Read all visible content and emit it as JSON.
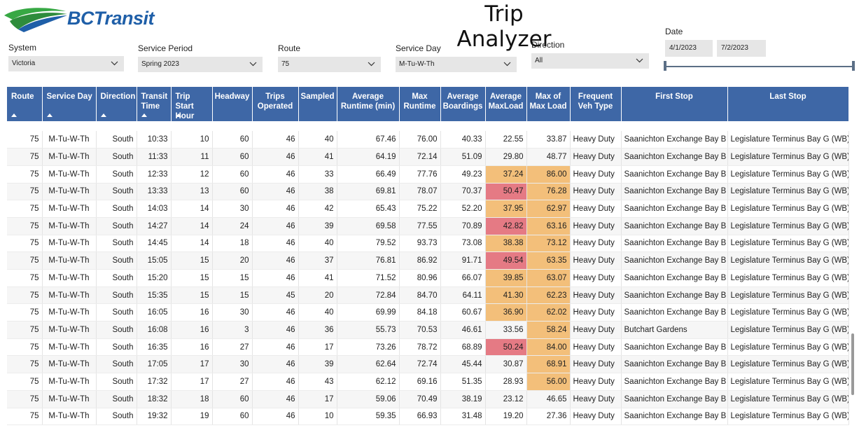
{
  "app": {
    "logo_text": "BCTransit",
    "title": "Trip Analyzer"
  },
  "colors": {
    "header_bg": "#3e67a6",
    "high_red": "#e57a84",
    "high_orange": "#f3bf7a",
    "brand_blue": "#1f5fa8",
    "brand_green": "#37a844"
  },
  "slicers": {
    "system": {
      "label": "System",
      "value": "Victoria"
    },
    "service_period": {
      "label": "Service Period",
      "value": "Spring 2023"
    },
    "route": {
      "label": "Route",
      "value": "75"
    },
    "service_day": {
      "label": "Service Day",
      "value": "M-Tu-W-Th"
    },
    "direction": {
      "label": "Direction",
      "value": "All"
    },
    "date": {
      "label": "Date",
      "start": "4/1/2023",
      "end": "7/2/2023"
    }
  },
  "table": {
    "columns": [
      "Route",
      "Service Day",
      "Direction",
      "Transit Time",
      "Trip Start Hour",
      "Headway",
      "Trips Operated",
      "Sampled",
      "Average Runtime (min)",
      "Max Runtime",
      "Average Boardings",
      "Average MaxLoad",
      "Max of Max Load",
      "Frequent Veh Type",
      "First Stop",
      "Last Stop"
    ],
    "rows": [
      [
        "75",
        "M-Tu-W-Th",
        "South",
        "10:33",
        "10",
        "60",
        "46",
        "40",
        "67.46",
        "76.00",
        "40.33",
        "22.55",
        "33.87",
        "Heavy Duty",
        "Saanichton Exchange Bay B",
        "Legislature Terminus Bay G (WB)"
      ],
      [
        "75",
        "M-Tu-W-Th",
        "South",
        "11:33",
        "11",
        "60",
        "46",
        "41",
        "64.19",
        "72.14",
        "51.09",
        "29.80",
        "48.77",
        "Heavy Duty",
        "Saanichton Exchange Bay B",
        "Legislature Terminus Bay G (WB)"
      ],
      [
        "75",
        "M-Tu-W-Th",
        "South",
        "12:33",
        "12",
        "60",
        "46",
        "33",
        "66.49",
        "77.76",
        "49.23",
        "37.24",
        "86.00",
        "Heavy Duty",
        "Saanichton Exchange Bay B",
        "Legislature Terminus Bay G (WB)"
      ],
      [
        "75",
        "M-Tu-W-Th",
        "South",
        "13:33",
        "13",
        "60",
        "46",
        "38",
        "69.81",
        "78.07",
        "70.37",
        "50.47",
        "76.28",
        "Heavy Duty",
        "Saanichton Exchange Bay B",
        "Legislature Terminus Bay G (WB)"
      ],
      [
        "75",
        "M-Tu-W-Th",
        "South",
        "14:03",
        "14",
        "30",
        "46",
        "42",
        "65.43",
        "75.22",
        "52.20",
        "37.95",
        "62.97",
        "Heavy Duty",
        "Saanichton Exchange Bay B",
        "Legislature Terminus Bay G (WB)"
      ],
      [
        "75",
        "M-Tu-W-Th",
        "South",
        "14:27",
        "14",
        "24",
        "46",
        "39",
        "69.58",
        "77.55",
        "70.89",
        "42.82",
        "63.16",
        "Heavy Duty",
        "Saanichton Exchange Bay B",
        "Legislature Terminus Bay G (WB)"
      ],
      [
        "75",
        "M-Tu-W-Th",
        "South",
        "14:45",
        "14",
        "18",
        "46",
        "40",
        "79.52",
        "93.73",
        "73.08",
        "38.38",
        "73.12",
        "Heavy Duty",
        "Saanichton Exchange Bay B",
        "Legislature Terminus Bay G (WB)"
      ],
      [
        "75",
        "M-Tu-W-Th",
        "South",
        "15:05",
        "15",
        "20",
        "46",
        "37",
        "76.81",
        "86.92",
        "91.71",
        "49.54",
        "63.35",
        "Heavy Duty",
        "Saanichton Exchange Bay B",
        "Legislature Terminus Bay G (WB)"
      ],
      [
        "75",
        "M-Tu-W-Th",
        "South",
        "15:20",
        "15",
        "15",
        "46",
        "41",
        "71.52",
        "80.96",
        "66.07",
        "39.85",
        "63.07",
        "Heavy Duty",
        "Saanichton Exchange Bay B",
        "Legislature Terminus Bay G (WB)"
      ],
      [
        "75",
        "M-Tu-W-Th",
        "South",
        "15:35",
        "15",
        "15",
        "45",
        "20",
        "72.84",
        "84.70",
        "64.11",
        "41.30",
        "62.23",
        "Heavy Duty",
        "Saanichton Exchange Bay B",
        "Legislature Terminus Bay G (WB)"
      ],
      [
        "75",
        "M-Tu-W-Th",
        "South",
        "16:05",
        "16",
        "30",
        "46",
        "40",
        "69.99",
        "84.18",
        "60.67",
        "36.90",
        "62.02",
        "Heavy Duty",
        "Saanichton Exchange Bay B",
        "Legislature Terminus Bay G (WB)"
      ],
      [
        "75",
        "M-Tu-W-Th",
        "South",
        "16:08",
        "16",
        "3",
        "46",
        "36",
        "55.73",
        "70.53",
        "46.61",
        "33.56",
        "58.24",
        "Heavy Duty",
        "Butchart Gardens",
        "Legislature Terminus Bay G (WB)"
      ],
      [
        "75",
        "M-Tu-W-Th",
        "South",
        "16:35",
        "16",
        "27",
        "46",
        "17",
        "73.26",
        "78.72",
        "68.89",
        "50.24",
        "84.00",
        "Heavy Duty",
        "Saanichton Exchange Bay B",
        "Legislature Terminus Bay G (WB)"
      ],
      [
        "75",
        "M-Tu-W-Th",
        "South",
        "17:05",
        "17",
        "30",
        "46",
        "39",
        "62.64",
        "72.74",
        "45.44",
        "30.87",
        "68.91",
        "Heavy Duty",
        "Saanichton Exchange Bay B",
        "Legislature Terminus Bay G (WB)"
      ],
      [
        "75",
        "M-Tu-W-Th",
        "South",
        "17:32",
        "17",
        "27",
        "46",
        "43",
        "62.12",
        "69.16",
        "51.35",
        "28.93",
        "56.00",
        "Heavy Duty",
        "Saanichton Exchange Bay B",
        "Legislature Terminus Bay G (WB)"
      ],
      [
        "75",
        "M-Tu-W-Th",
        "South",
        "18:32",
        "18",
        "60",
        "46",
        "17",
        "59.06",
        "70.49",
        "38.19",
        "23.12",
        "46.65",
        "Heavy Duty",
        "Saanichton Exchange Bay B",
        "Legislature Terminus Bay G (WB)"
      ],
      [
        "75",
        "M-Tu-W-Th",
        "South",
        "19:32",
        "19",
        "60",
        "46",
        "10",
        "59.35",
        "66.93",
        "31.48",
        "19.20",
        "27.36",
        "Heavy Duty",
        "Saanichton Exchange Bay B",
        "Legislature Terminus Bay G (WB)"
      ]
    ],
    "highlights": {
      "avg_maxload": [
        "",
        "",
        "orange",
        "red",
        "orange",
        "red",
        "orange",
        "red",
        "orange",
        "orange",
        "orange",
        "",
        "red",
        "",
        "",
        "",
        ""
      ],
      "max_of_max_load": [
        "",
        "",
        "orange",
        "orange",
        "orange",
        "orange",
        "orange",
        "orange",
        "orange",
        "orange",
        "orange",
        "orange",
        "orange",
        "orange",
        "orange",
        "",
        ""
      ]
    }
  }
}
